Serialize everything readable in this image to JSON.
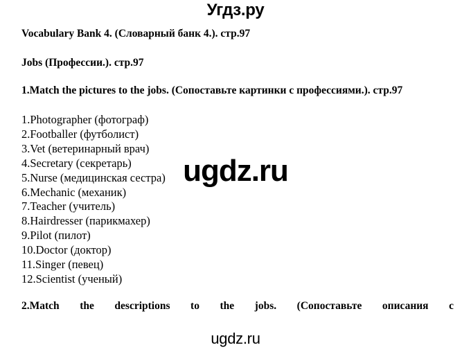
{
  "watermarks": {
    "top": "Угдз.ру",
    "center": "ugdz.ru",
    "bottom": "ugdz.ru"
  },
  "document": {
    "headings": {
      "vocabulary_bank": "Vocabulary Bank 4. (Словарный банк 4.). стр.97",
      "jobs": "Jobs (Профессии.). стр.97"
    },
    "tasks": [
      {
        "number": "1.",
        "text": "1.Match the pictures to the jobs. (Сопоставьте картинки с профессиями.). стр.97"
      },
      {
        "number": "2.",
        "text": "2.Match the descriptions to the jobs. (Сопоставьте описания с"
      }
    ],
    "job_list": [
      "1.Photographer (фотограф)",
      "2.Footballer (футболист)",
      "3.Vet (ветеринарный врач)",
      "4.Secretary (секретарь)",
      "5.Nurse (медицинская сестра)",
      "6.Mechanic (механик)",
      "7.Teacher (учитель)",
      "8.Hairdresser (парикмахер)",
      "9.Pilot (пилот)",
      "10.Doctor (доктор)",
      "11.Singer (певец)",
      "12.Scientist (ученый)"
    ]
  },
  "colors": {
    "text": "#000000",
    "background": "#ffffff"
  }
}
